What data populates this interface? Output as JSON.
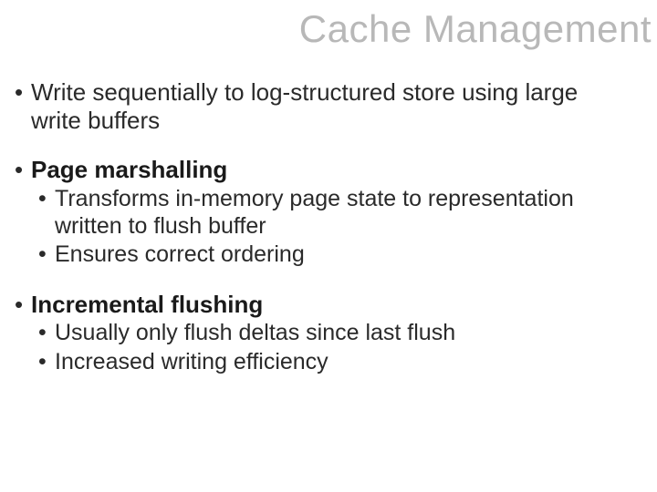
{
  "title": "Cache Management",
  "bullets": {
    "b1": "Write sequentially to log-structured store using large write buffers",
    "b2_head": "Page marshalling",
    "b2_sub1": "Transforms in-memory page state to representation written to flush buffer",
    "b2_sub2": "Ensures correct ordering",
    "b3_head": "Incremental flushing",
    "b3_sub1": "Usually only flush deltas since last flush",
    "b3_sub2": "Increased writing efficiency"
  }
}
